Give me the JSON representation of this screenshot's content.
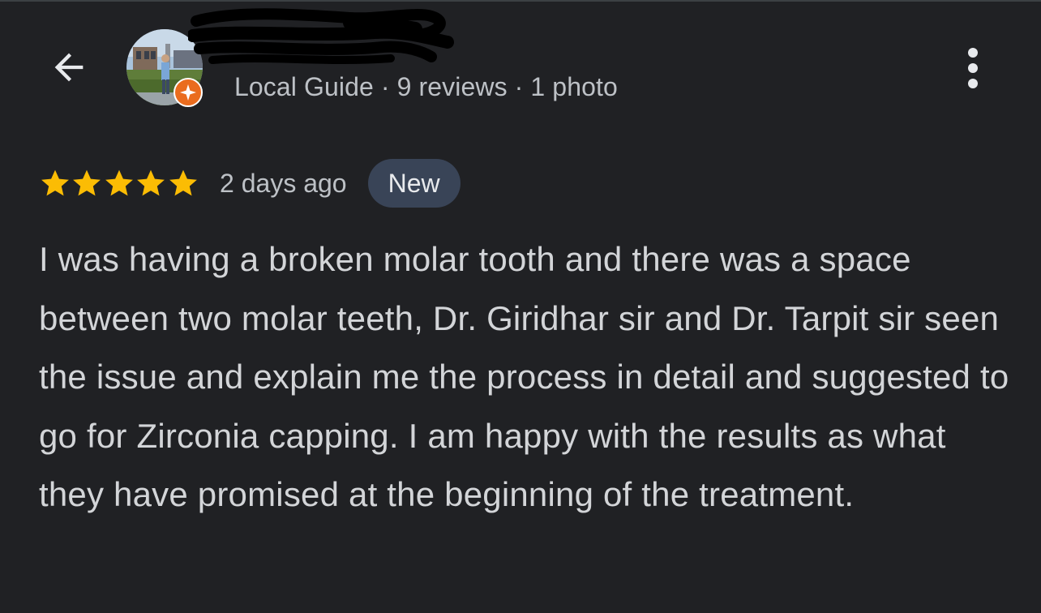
{
  "header": {
    "back_icon": "arrow-back-icon",
    "more_icon": "more-vert-icon",
    "reviewer_meta": "Local Guide · 9 reviews · 1 photo",
    "local_guide_badge_icon": "local-guide-star-icon"
  },
  "review": {
    "stars": 5,
    "star_color": "#fbbc04",
    "date": "2 days ago",
    "badge": "New",
    "text": "I was having a broken molar tooth and there was a space between two molar teeth, Dr. Giridhar sir and Dr. Tarpit sir seen the issue and explain me the process in detail and suggested to go for Zirconia capping. I am happy with the results as what they have promised at the beginning of the treatment."
  },
  "colors": {
    "background": "#202124",
    "primary_text": "#e8eaed",
    "secondary_text": "#bdc1c6",
    "badge_bg": "#394457",
    "guide_orange": "#ea6c1e"
  }
}
